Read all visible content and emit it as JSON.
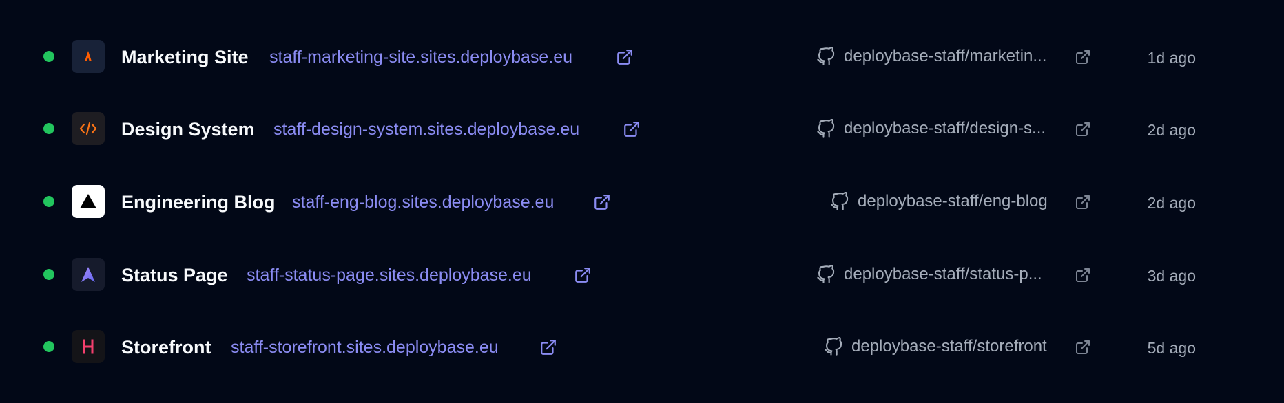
{
  "colors": {
    "background": "#020817",
    "status_ok": "#22c55e",
    "link": "#8b8cf3",
    "muted": "#a4acb9",
    "title": "#f8fafc"
  },
  "projects": [
    {
      "name": "Marketing Site",
      "domain": "staff-marketing-site.sites.deploybase.eu",
      "repo": "deploybase-staff/marketin...",
      "updated": "1d ago",
      "status": "ready",
      "logo": "astro-logo"
    },
    {
      "name": "Design System",
      "domain": "staff-design-system.sites.deploybase.eu",
      "repo": "deploybase-staff/design-s...",
      "updated": "2d ago",
      "status": "ready",
      "logo": "code-brackets-logo"
    },
    {
      "name": "Engineering Blog",
      "domain": "staff-eng-blog.sites.deploybase.eu",
      "repo": "deploybase-staff/eng-blog",
      "updated": "2d ago",
      "status": "ready",
      "logo": "triangle-logo"
    },
    {
      "name": "Status Page",
      "domain": "staff-status-page.sites.deploybase.eu",
      "repo": "deploybase-staff/status-p...",
      "updated": "3d ago",
      "status": "ready",
      "logo": "arrow-logo"
    },
    {
      "name": "Storefront",
      "domain": "staff-storefront.sites.deploybase.eu",
      "repo": "deploybase-staff/storefront",
      "updated": "5d ago",
      "status": "ready",
      "logo": "hydrogen-logo"
    }
  ]
}
